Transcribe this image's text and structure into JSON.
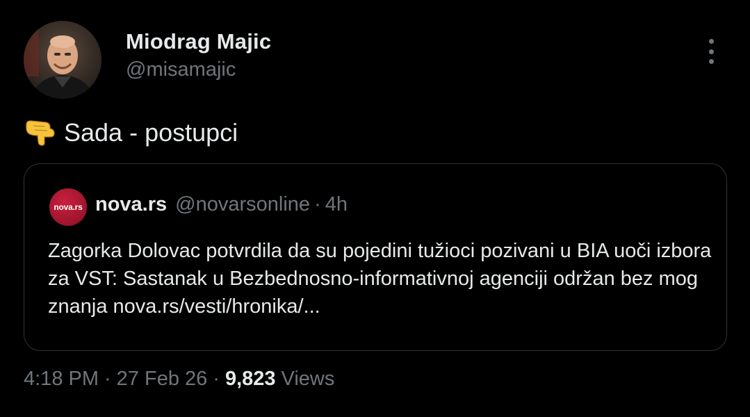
{
  "author": {
    "display_name": "Miodrag Majic",
    "handle": "@misamajic"
  },
  "tweet": {
    "emoji_icon": "backhand-index-pointing-down-icon",
    "text": "Sada - postupci"
  },
  "quote": {
    "avatar_text": "nova.rs",
    "name": "nova.rs",
    "handle": "@novarsonline",
    "separator": "·",
    "time": "4h",
    "text": "Zagorka Dolovac potvrdila da su pojedini tužioci pozivani u BIA uoči izbora za VST: Sastanak u Bezbednosno-informativnoj agenciji održan bez mog znanja nova.rs/vesti/hronika/..."
  },
  "meta": {
    "time": "4:18 PM",
    "separator": "·",
    "date": "27 Feb 26",
    "views_count": "9,823",
    "views_label": "Views"
  },
  "colors": {
    "background": "#000000",
    "text_primary": "#e7e9ea",
    "text_secondary": "#71767b",
    "border": "#2f3336",
    "nova_brand": "#c9203e"
  }
}
